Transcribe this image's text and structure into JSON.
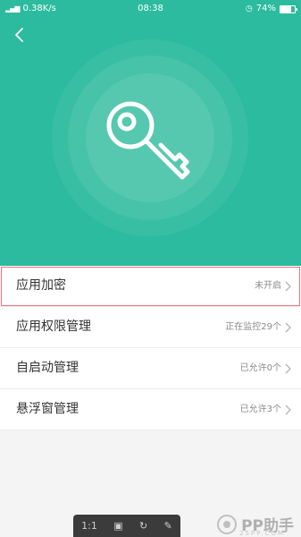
{
  "status_bar": {
    "network_speed": "0.38K/s",
    "time": "08:38",
    "battery": "74%",
    "battery_level": 0.74
  },
  "hero": {
    "color": "#2cbb9e",
    "icon": "key-icon"
  },
  "settings": [
    {
      "label": "应用加密",
      "value": "未开启"
    },
    {
      "label": "应用权限管理",
      "value": "正在监控29个"
    },
    {
      "label": "自启动管理",
      "value": "已允许0个"
    },
    {
      "label": "悬浮窗管理",
      "value": "已允许3个"
    }
  ],
  "toolbar": {
    "zoom": "1:1"
  },
  "watermark": {
    "text": "PP助手",
    "sub": "25PP.COM"
  }
}
